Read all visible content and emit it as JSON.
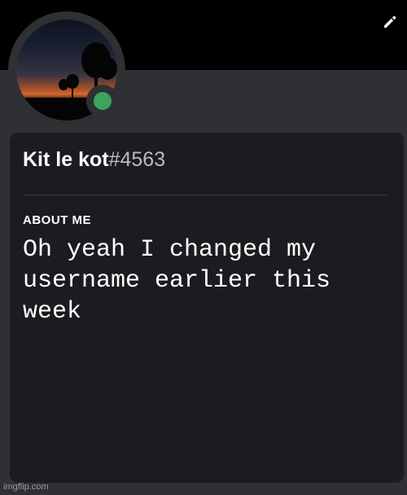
{
  "profile": {
    "username": "Kit le kot",
    "discriminator": "#4563",
    "status": "online",
    "status_color": "#3ba55c",
    "edit_icon": "pencil-icon"
  },
  "about": {
    "label": "ABOUT ME",
    "text": "Oh yeah I changed my username earlier this week"
  },
  "watermark": "imgflip.com",
  "colors": {
    "banner": "#000000",
    "background": "#2f3033",
    "card": "#1b1c1f"
  }
}
